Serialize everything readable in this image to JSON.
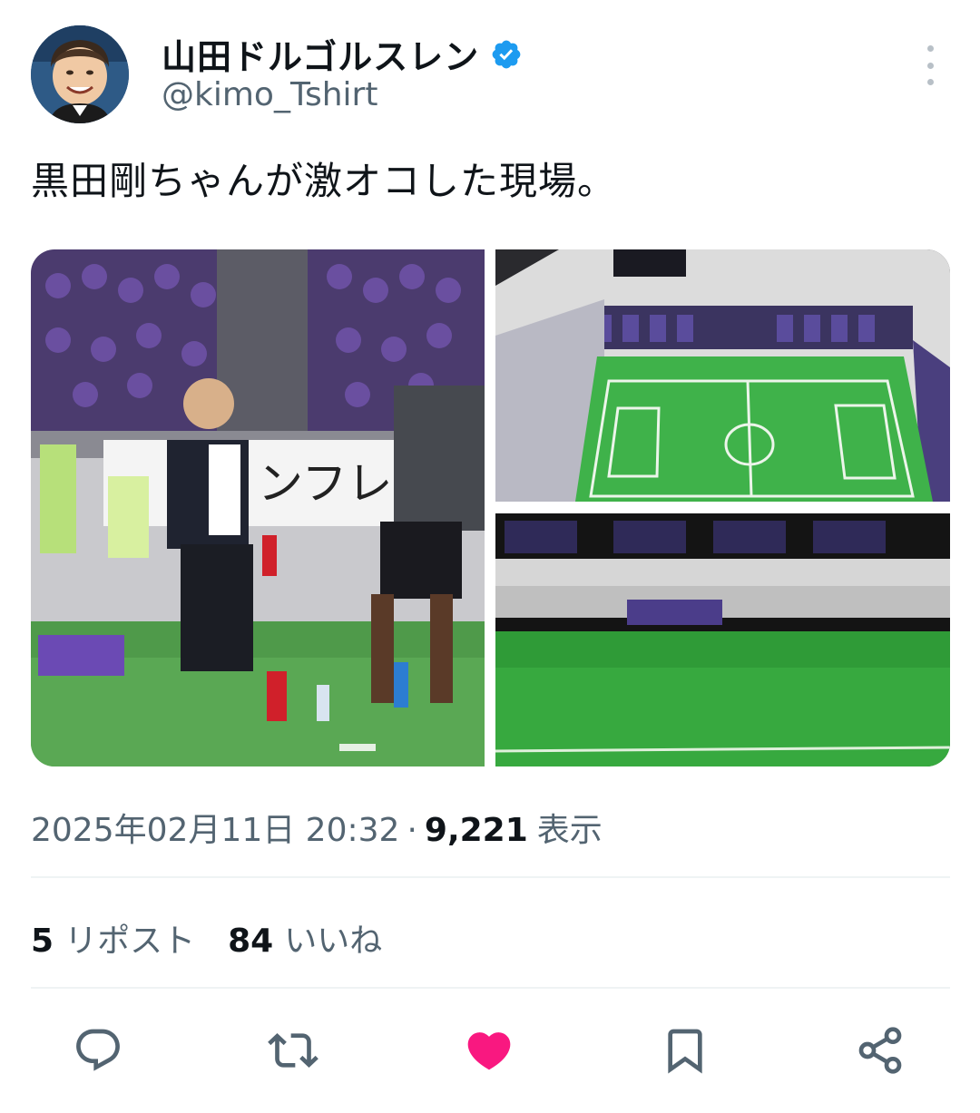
{
  "author": {
    "display_name": "山田ドルゴルスレン",
    "handle": "@kimo_Tshirt",
    "verified": true
  },
  "tweet": {
    "text": "黒田剛ちゃんが激オコした現場。",
    "timestamp": "2025年02月11日 20:32",
    "separator": "·",
    "views_count": "9,221",
    "views_label": "表示"
  },
  "stats": {
    "reposts_count": "5",
    "reposts_label": "リポスト",
    "likes_count": "84",
    "likes_label": "いいね"
  },
  "media": {
    "banner_text": "ンフレッ"
  },
  "actions": {
    "icons": [
      "reply-icon",
      "repost-icon",
      "like-icon",
      "bookmark-icon",
      "share-icon"
    ],
    "like_color": "#f91880",
    "icon_color": "#536471"
  },
  "colors": {
    "verified": "#1d9bf0",
    "text_primary": "#0f1419",
    "text_secondary": "#536471"
  }
}
